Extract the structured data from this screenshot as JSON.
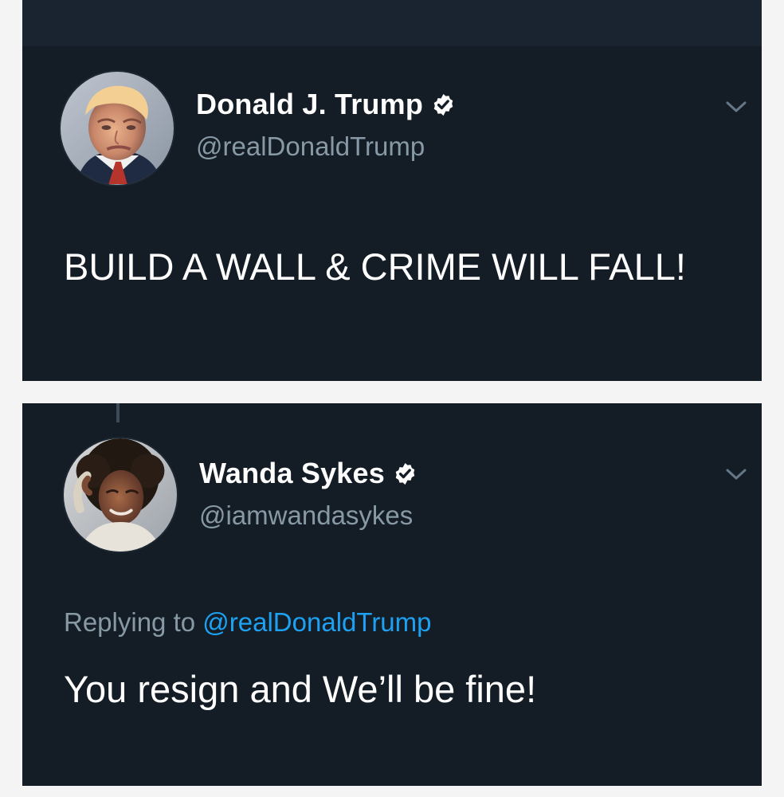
{
  "tweets": [
    {
      "display_name": "Donald J. Trump",
      "handle": "@realDonaldTrump",
      "verified": true,
      "text": "BUILD A WALL & CRIME WILL FALL!"
    },
    {
      "display_name": "Wanda Sykes",
      "handle": "@iamwandasykes",
      "verified": true,
      "reply_prefix": "Replying to",
      "reply_to": "@realDonaldTrump",
      "text": "You resign and We’ll be fine!"
    }
  ],
  "icons": {
    "verified": "verified-badge-icon",
    "menu": "chevron-down-icon"
  },
  "colors": {
    "card_background": "#141d26",
    "handle": "#8899a6",
    "link": "#1da1f2",
    "verified_badge": "#ffffff"
  }
}
